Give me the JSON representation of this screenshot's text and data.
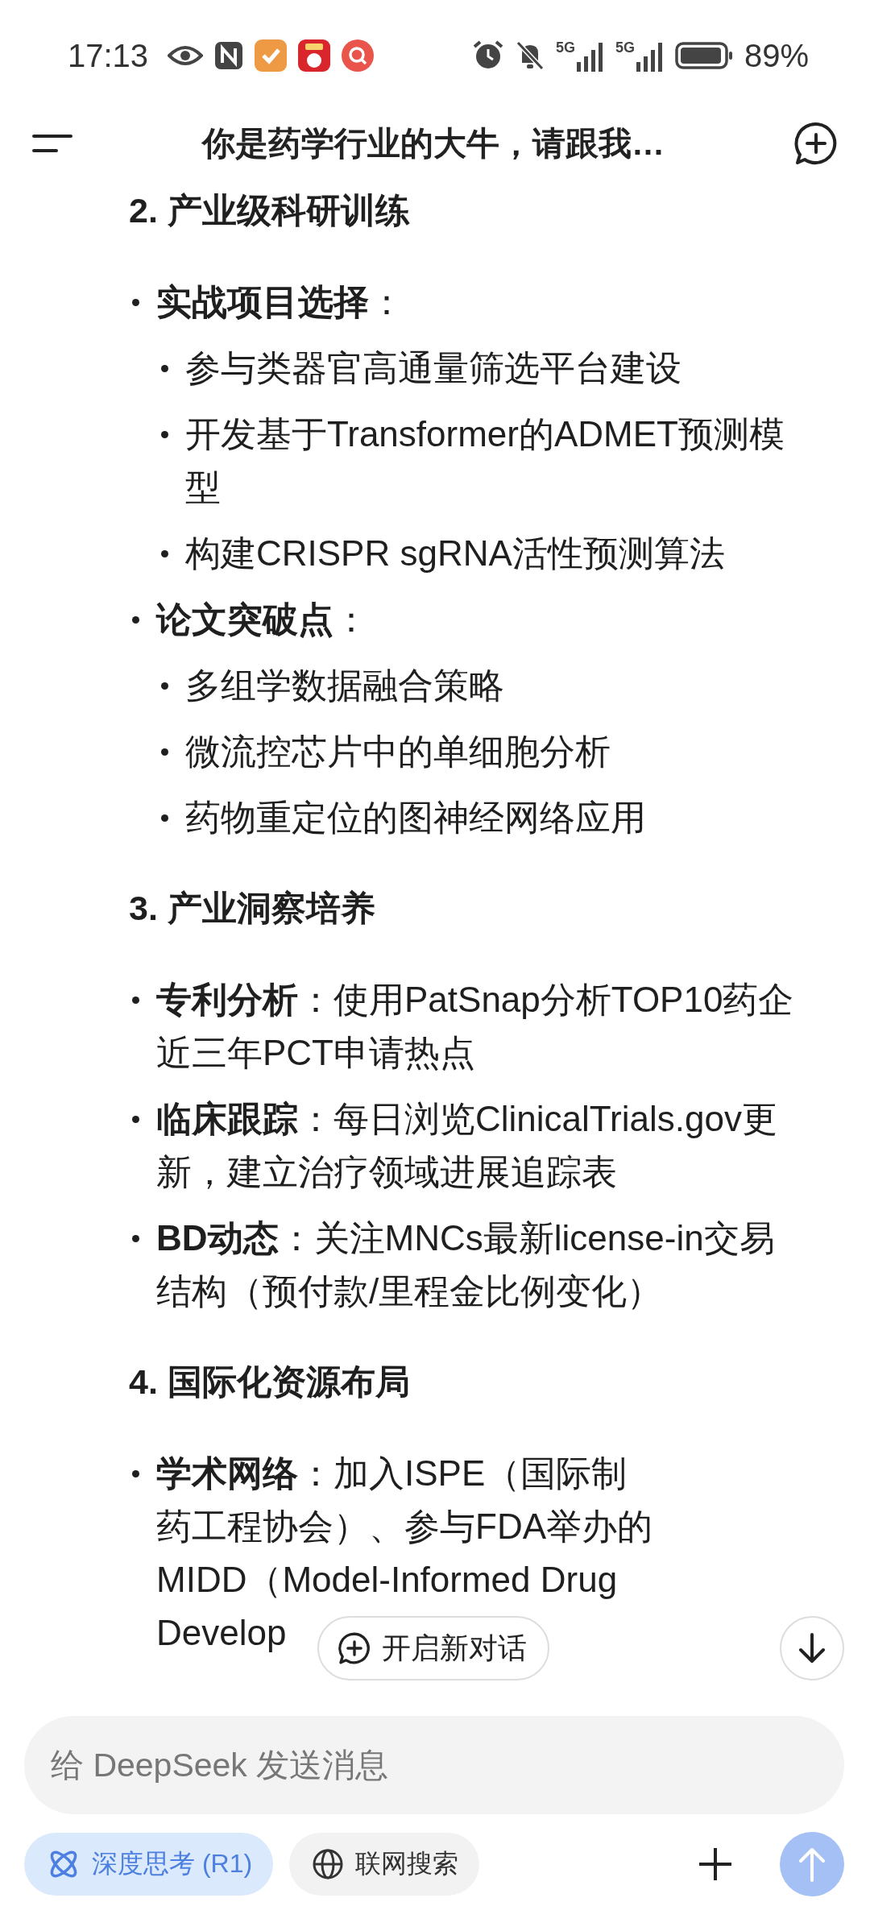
{
  "status_bar": {
    "time": "17:13",
    "signals": [
      {
        "label": "5G"
      },
      {
        "label": "5G"
      }
    ],
    "battery": "89%"
  },
  "header": {
    "title": "你是药学行业的大牛，请跟我…"
  },
  "sections": [
    {
      "heading": "2. 产业级科研训练",
      "items": [
        {
          "lines": [
            "**实战项目选择**："
          ],
          "children": [
            {
              "lines": [
                "参与类器官高通量筛选平台建设"
              ]
            },
            {
              "lines": [
                "开发基于Transformer的ADMET预测模",
                "型"
              ]
            },
            {
              "lines": [
                "构建CRISPR sgRNA活性预测算法"
              ]
            }
          ]
        },
        {
          "lines": [
            "**论文突破点**："
          ],
          "children": [
            {
              "lines": [
                "多组学数据融合策略"
              ]
            },
            {
              "lines": [
                "微流控芯片中的单细胞分析"
              ]
            },
            {
              "lines": [
                "药物重定位的图神经网络应用"
              ]
            }
          ]
        }
      ]
    },
    {
      "heading": "3. 产业洞察培养",
      "items": [
        {
          "lines": [
            "**专利分析**：使用PatSnap分析TOP10药企",
            "近三年PCT申请热点"
          ]
        },
        {
          "lines": [
            "**临床跟踪**：每日浏览ClinicalTrials.gov更",
            "新，建立治疗领域进展追踪表"
          ]
        },
        {
          "lines": [
            "**BD动态**：关注MNCs最新license-in交易",
            "结构（预付款/里程金比例变化）"
          ]
        }
      ]
    },
    {
      "heading": "4. 国际化资源布局",
      "items": [
        {
          "lines": [
            "**学术网络**：加入ISPE（国际制",
            "药工程协会）、参与FDA举办的",
            "MIDD（Model-Informed Drug",
            "Develop"
          ]
        }
      ]
    }
  ],
  "new_chat_button": "开启新对话",
  "input": {
    "placeholder": "给 DeepSeek 发送消息"
  },
  "chips": [
    {
      "label": "深度思考 (R1)",
      "kind": "think",
      "selected": true
    },
    {
      "label": "联网搜索",
      "kind": "web",
      "selected": false
    }
  ]
}
